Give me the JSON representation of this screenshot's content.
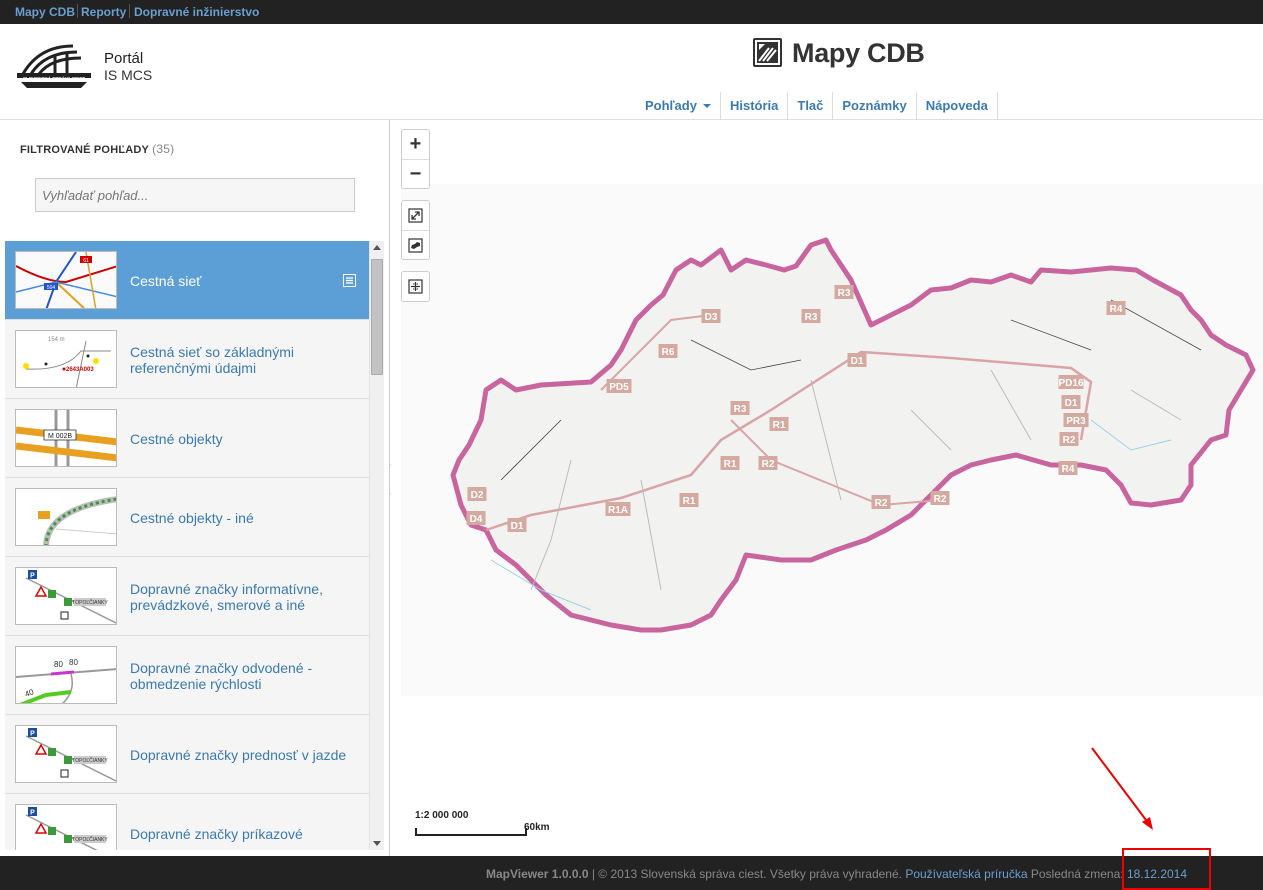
{
  "topbar": {
    "links": [
      "Mapy CDB",
      "Reporty",
      "Dopravné inžinierstvo"
    ]
  },
  "header": {
    "logo_text": "SLOVENSKÁ SPRÁVA CIEST",
    "portal_title": "Portál",
    "portal_subtitle": "IS MCS",
    "app_title": "Mapy CDB",
    "nav": [
      {
        "label": "Pohľady",
        "dropdown": true
      },
      {
        "label": "História"
      },
      {
        "label": "Tlač"
      },
      {
        "label": "Poznámky"
      },
      {
        "label": "Nápoveda"
      }
    ]
  },
  "sidebar": {
    "title": "FILTROVANÉ POHĽADY",
    "count": "(35)",
    "search_placeholder": "Vyhľadať pohľad...",
    "items": [
      {
        "label": "Cestná sieť",
        "active": true
      },
      {
        "label": "Cestná sieť so základnými referenčnými údajmi"
      },
      {
        "label": "Cestné objekty"
      },
      {
        "label": "Cestné objekty - iné"
      },
      {
        "label": "Dopravné značky informatívne, prevádzkové, smerové a iné"
      },
      {
        "label": "Dopravné značky odvodené - obmedzenie rýchlosti"
      },
      {
        "label": "Dopravné značky prednosť v jazde"
      },
      {
        "label": "Dopravné značky príkazové"
      }
    ],
    "thumb_labels": {
      "road_number_1": "61",
      "road_number_2": "504",
      "object_code": "M 002B",
      "ref_code": "2643A003",
      "distance": "154 m",
      "speed_1": "80",
      "speed_2": "80",
      "speed_3": "40",
      "sign_p": "P",
      "place": "TOPOĽČIANKY"
    }
  },
  "map": {
    "scale_ratio": "1:2 000 000",
    "scale_km": "60km",
    "road_labels": [
      "D3",
      "R3",
      "R3",
      "R4",
      "R6",
      "D1",
      "PD5",
      "PD16",
      "D1",
      "R3",
      "PR3",
      "R1",
      "R2",
      "R1",
      "R2",
      "R4",
      "D2",
      "R1",
      "R1A",
      "R2",
      "R2",
      "D4",
      "D1"
    ],
    "colors": {
      "border": "#c9659e",
      "highway_label_bg": "#d4a99f"
    }
  },
  "footer": {
    "version": "MapViewer 1.0.0.0",
    "copyright": " | © 2013 Slovenská správa ciest. Všetky práva vyhradené. ",
    "manual_link": "Používateľská príručka",
    "last_change_label": " Posledná zmena: ",
    "last_change_date": "18.12.2014"
  }
}
